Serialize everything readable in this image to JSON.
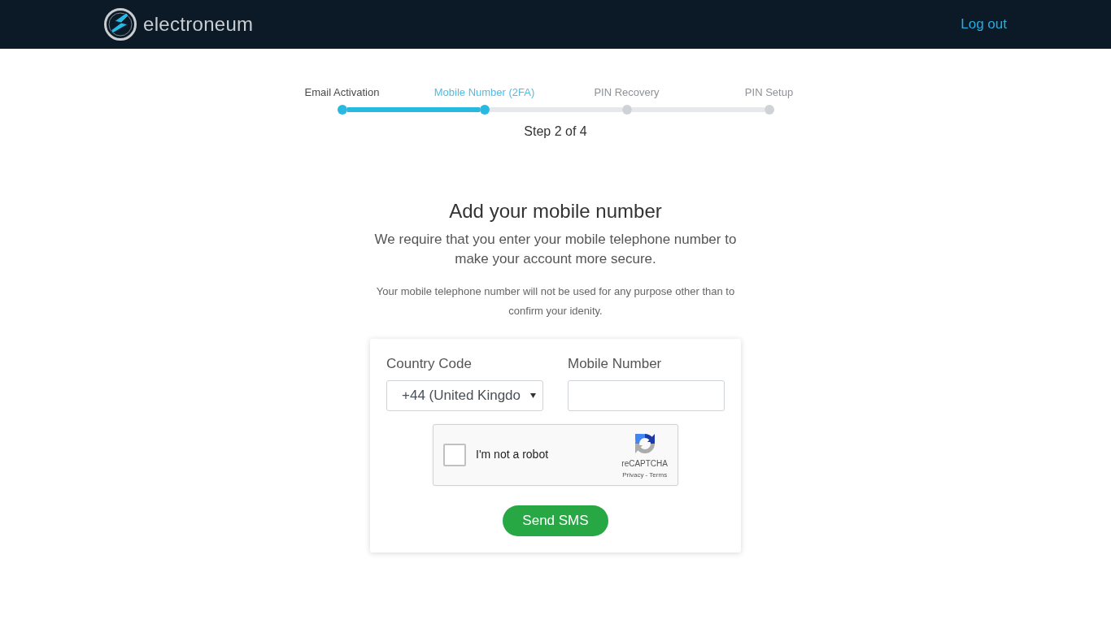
{
  "header": {
    "brand": "electroneum",
    "logout": "Log out"
  },
  "stepper": {
    "steps": [
      {
        "label": "Email Activation",
        "completed": true,
        "selected": false
      },
      {
        "label": "Mobile Number (2FA)",
        "completed": false,
        "selected": true
      },
      {
        "label": "PIN Recovery",
        "completed": false,
        "selected": false
      },
      {
        "label": "PIN Setup",
        "completed": false,
        "selected": false
      }
    ],
    "caption": "Step 2 of 4"
  },
  "form": {
    "title": "Add your mobile number",
    "intro": "We require that you enter your mobile telephone number to make your account more secure.",
    "note": "Your mobile telephone number will not be used for any purpose other than to confirm your idenity.",
    "fields": [
      {
        "kind": "select",
        "label": "Country Code",
        "value": "+44 (United Kingdo"
      },
      {
        "kind": "input",
        "label": "Mobile Number"
      }
    ],
    "captcha": {
      "label": "I'm not a robot",
      "checked": false,
      "brand": "reCAPTCHA",
      "links": "Privacy - Terms"
    },
    "submit": "Send SMS"
  }
}
